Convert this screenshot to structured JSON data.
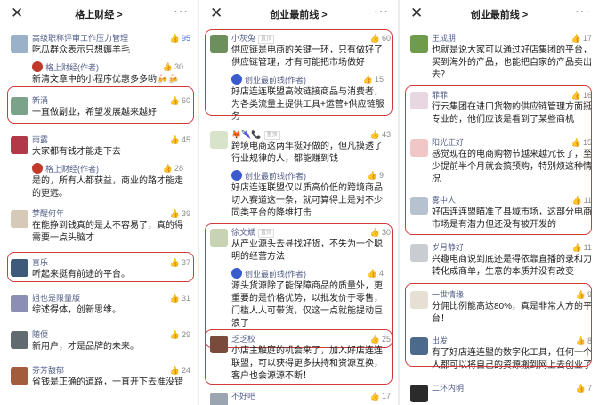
{
  "screens": [
    {
      "nav": {
        "close": "✕",
        "title": "格上财经 >",
        "more": "···"
      },
      "comments": [
        {
          "user": "高级职称评审工作压力管理",
          "text": "吃瓜群众表示只想薅羊毛",
          "likes": "95",
          "hot": true,
          "reply": {
            "user": "格上财经(作者)",
            "text": "新清文章中的小程序优惠多多哟🍻🍻",
            "likes": "30"
          }
        },
        {
          "user": "新涌",
          "text": "一直做副业，希望发展越来越好",
          "likes": "60"
        },
        {
          "user": "雨露",
          "text": "大家都有钱才能走下去",
          "likes": "45",
          "reply": {
            "user": "格上财经(作者)",
            "text": "是的，所有人都获益，商业的路才能走的更远。",
            "likes": "28"
          }
        },
        {
          "user": "梦醒何年",
          "text": "在能挣到钱真的是太不容易了，真的得需要一点头脑才",
          "likes": "39"
        },
        {
          "user": "喜乐",
          "text": "听起来挺有前途的平台。",
          "likes": "37"
        },
        {
          "user": "姐也是限量版",
          "text": "综述得体，创新思维。",
          "likes": "31"
        },
        {
          "user": "随便",
          "text": "新用户，才是品牌的未来。",
          "likes": "29"
        },
        {
          "user": "芬芳馥郁",
          "text": "省钱是正确的道路，一直开下去准没错",
          "likes": "24"
        }
      ]
    },
    {
      "nav": {
        "close": "✕",
        "title": "创业最前线 >",
        "more": "···"
      },
      "comments": [
        {
          "user": "小灰兔",
          "badge": "置顶",
          "text": "供应链是电商的关键一环，只有做好了供应链管理，才有可能把市场做好",
          "likes": "60",
          "reply": {
            "user": "创业最前线(作者)",
            "text": "好店连连联盟高效链接商品与消费者，为各类流量主提供工具+运营+供应链服务",
            "likes": "15"
          }
        },
        {
          "user": "🦊🌂📞",
          "badge": "置顶",
          "text": "跨境电商这两年挺好做的，但凡摸透了行业规律的人，都能赚到钱",
          "likes": "43",
          "reply": {
            "user": "创业最前线(作者)",
            "text": "好店连连联盟仅以质高价低的跨境商品切入赛道这一条，就可算得上是对不少同类平台的降维打击",
            "likes": "9"
          }
        },
        {
          "user": "徐文斌",
          "badge": "置顶",
          "text": "从产业源头去寻找好货，不失为一个聪明的经营方法",
          "likes": "30",
          "reply": {
            "user": "创业最前线(作者)",
            "text": "源头货源除了能保障商品的质量外，更重要的是价格优势，以批发价于零售，门槛人人可带货，仅这一点就能提动巨浪了",
            "likes": "4"
          }
        },
        {
          "user": "乏乏校",
          "text": "小店主触庭的机会来了，加入好店连连联盟，可以获得更多扶持和资源互换，客户也会源源不断！",
          "likes": "25"
        },
        {
          "user": "不好吧",
          "text": "",
          "likes": "17"
        }
      ]
    },
    {
      "nav": {
        "close": "✕",
        "title": "创业最前线 >",
        "more": "···"
      },
      "comments": [
        {
          "user": "王成朋",
          "text": "也就是说大家可以通过好店集团的平台，买到海外的产品，也能把自家的产品卖出去？",
          "likes": "17"
        },
        {
          "user": "菲菲",
          "text": "行云集团在进口货物的供应链管理方面挺专业的，他们应该是看到了某些商机",
          "likes": "16"
        },
        {
          "user": "阳光正好",
          "text": "感觉现在的电商购物节越来越冗长了，至少提前半个月就会搞预购，特别烦这种情况",
          "likes": "15"
        },
        {
          "user": "雾中人",
          "text": "好店连连盟瞄准了县域市场，这部分电商市场是有潜力但还没有被开发的",
          "likes": "11"
        },
        {
          "user": "岁月静好",
          "text": "兴趣电商说到底还是得依靠直播的录和力转化成商单，生意的本质并没有改变",
          "likes": "11"
        },
        {
          "user": "一世情缘",
          "text": "分佣比例能高达80%，真是非常大方的平台！",
          "likes": "9"
        },
        {
          "user": "出发",
          "text": "有了好店连连盟的数字化工具，任何一个人都可以将自己的资源搬到网上去创业了",
          "likes": "8"
        },
        {
          "user": "二环内明",
          "text": "",
          "likes": "7"
        }
      ]
    }
  ],
  "colors": {
    "highlight": "#d23a3a",
    "username": "#55608a",
    "hot_like": "#4a6fd6"
  }
}
